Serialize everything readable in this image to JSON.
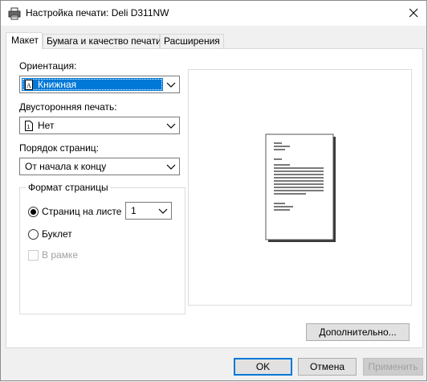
{
  "window": {
    "title": "Настройка печати: Deli D311NW",
    "icon": "printer-icon",
    "close_icon": "close-icon"
  },
  "tabs": [
    {
      "label": "Макет",
      "active": true
    },
    {
      "label": "Бумага и качество печати",
      "active": false
    },
    {
      "label": "Расширения",
      "active": false
    }
  ],
  "layout": {
    "orientation": {
      "label": "Ориентация:",
      "value": "Книжная",
      "icon": "portrait-page-icon"
    },
    "duplex": {
      "label": "Двусторонняя печать:",
      "value": "Нет",
      "icon": "single-page-icon"
    },
    "page_order": {
      "label": "Порядок страниц:",
      "value": "От начала к концу"
    },
    "page_format": {
      "legend": "Формат страницы",
      "pages_per_sheet": {
        "label": "Страниц на листе",
        "checked": true,
        "value": "1"
      },
      "booklet": {
        "label": "Буклет",
        "checked": false
      },
      "border": {
        "label": "В рамке",
        "checked": false,
        "enabled": false
      }
    },
    "advanced_label": "Дополнительно..."
  },
  "footer": {
    "ok": "OK",
    "cancel": "Отмена",
    "apply": "Применить"
  },
  "colors": {
    "accent": "#0078d7",
    "window_bg": "#f0f0f0"
  }
}
